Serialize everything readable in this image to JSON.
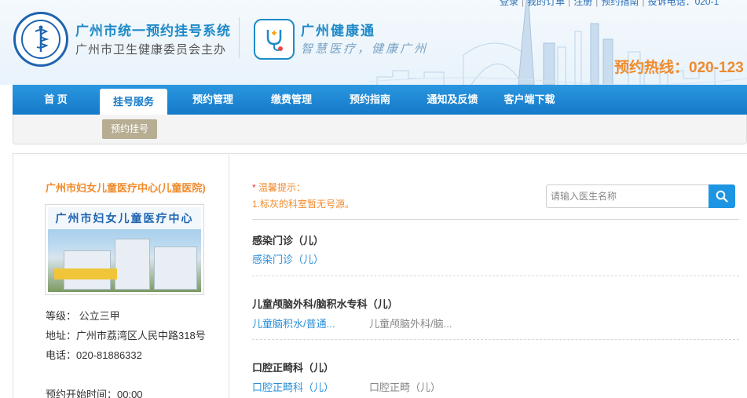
{
  "top_links": [
    "登录",
    "我的订单",
    "注册",
    "预约指南",
    "投诉电话：020-1"
  ],
  "header": {
    "title": "广州市统一预约挂号系统",
    "subtitle": "广州市卫生健康委员会主办",
    "app_name": "广州健康通",
    "app_slogan": "智慧医疗，健康广州",
    "hotline": "预约热线：020-123"
  },
  "nav": {
    "items": [
      "首 页",
      "挂号服务",
      "预约管理",
      "缴费管理",
      "预约指南",
      "通知及反馈",
      "客户端下载"
    ],
    "active_index": 1,
    "sub_item": "预约挂号"
  },
  "hospital": {
    "name": "广州市妇女儿童医疗中心(儿童医院)",
    "image_banner": "广州市妇女儿童医疗中心",
    "level": "等级：  公立三甲",
    "address": "地址：广州市荔湾区人民中路318号",
    "phone": "电话：020-81886332",
    "booking_time": "预约开始时间：00:00"
  },
  "notice": {
    "title": "温馨提示：",
    "text": "1.标灰的科室暂无号源。"
  },
  "search": {
    "placeholder": "请输入医生名称"
  },
  "departments": [
    {
      "title": "感染门诊（儿）",
      "items": [
        {
          "label": "感染门诊（儿）",
          "available": true
        }
      ]
    },
    {
      "title": "儿童颅脑外科/脑积水专科（儿）",
      "items": [
        {
          "label": "儿童脑积水/普通...",
          "available": true
        },
        {
          "label": "儿童颅脑外科/脑...",
          "available": false
        }
      ]
    },
    {
      "title": "口腔正畸科（儿）",
      "items": [
        {
          "label": "口腔正畸科（儿）",
          "available": true
        },
        {
          "label": "口腔正畸（儿）",
          "available": false
        }
      ]
    }
  ],
  "colors": {
    "nav_blue": "#1479c9",
    "accent_orange": "#f08a2b",
    "link_blue": "#2b8fd8",
    "unavailable_grey": "#888888"
  }
}
